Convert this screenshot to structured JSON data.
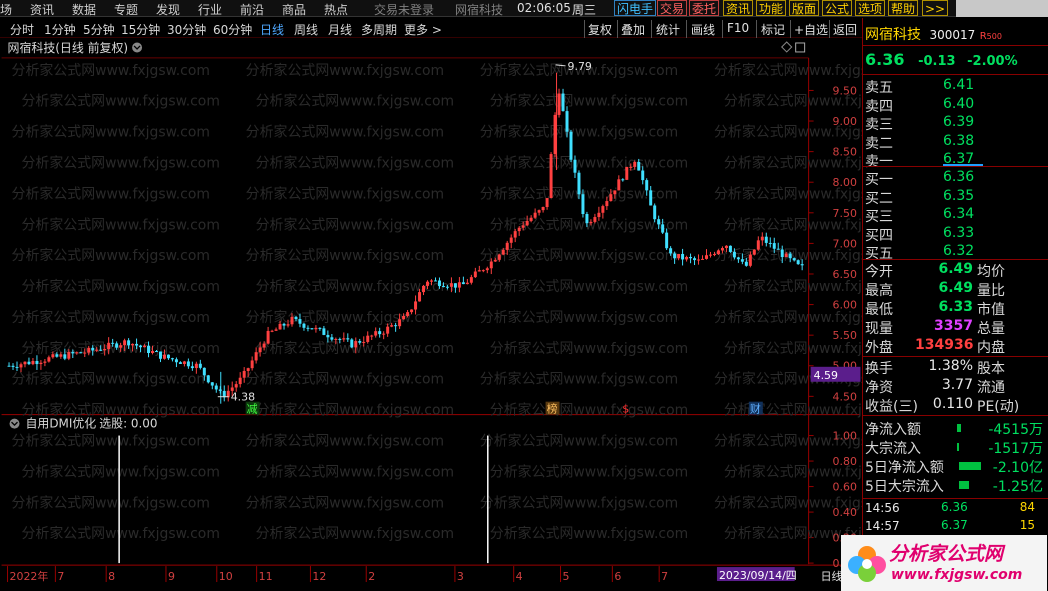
{
  "topmenu": {
    "items": [
      "场",
      "资讯",
      "数据",
      "专题",
      "发现",
      "行业",
      "前沿",
      "商品",
      "热点"
    ],
    "trade_status": "交易未登录",
    "stock_name": "网宿科技",
    "clock": "02:06:05",
    "weekday": "周三",
    "buttons": [
      "闪电手",
      "交易",
      "委托",
      "资讯",
      "功能",
      "版面",
      "公式",
      "选项",
      "帮助",
      ">>"
    ]
  },
  "periodbar": {
    "periods": [
      "分时",
      "1分钟",
      "5分钟",
      "15分钟",
      "30分钟",
      "60分钟",
      "日线",
      "周线",
      "月线",
      "多周期",
      "更多 >"
    ],
    "active_index": 6,
    "tools": [
      "复权",
      "叠加",
      "统计",
      "画线",
      "F10",
      "标记",
      "+自选",
      "返回"
    ]
  },
  "chart": {
    "title": "网宿科技(日线 前复权)",
    "watermark": "分析家公式网www.fxjgsw.com",
    "high_label": "9.79",
    "low_label": "4.38",
    "current_marker": "4.59",
    "events": [
      "减",
      "榜",
      "$",
      "财"
    ],
    "indicator_title": "自用DMI优化",
    "indicator_value": "选股: 0.00",
    "date_ticks": [
      "2022年",
      "7",
      "8",
      "9",
      "10",
      "11",
      "12",
      "2",
      "3",
      "4",
      "5",
      "6",
      "7"
    ],
    "date_current": "2023/09/14/四",
    "date_mode": "日线"
  },
  "chart_data": {
    "type": "candlestick",
    "ylim": [
      4.25,
      9.95
    ],
    "yticks": [
      "9.50",
      "9.00",
      "8.50",
      "8.00",
      "7.50",
      "7.00",
      "6.50",
      "6.00",
      "5.50",
      "5.00",
      "4.50"
    ],
    "indicator_ylim": [
      0,
      1
    ],
    "indicator_yticks": [
      "1.00",
      "0.80",
      "0.60",
      "0.40",
      "0.20",
      "0.00"
    ],
    "signals": [
      1,
      1
    ]
  },
  "quote": {
    "name": "网宿科技",
    "code": "300017",
    "badge": "R",
    "badge_num": "500",
    "price": "6.36",
    "change": "-0.13",
    "change_pct": "-2.00%",
    "asks": [
      {
        "label": "卖五",
        "price": "6.41"
      },
      {
        "label": "卖四",
        "price": "6.40"
      },
      {
        "label": "卖三",
        "price": "6.39"
      },
      {
        "label": "卖二",
        "price": "6.38"
      },
      {
        "label": "卖一",
        "price": "6.37"
      }
    ],
    "bids": [
      {
        "label": "买一",
        "price": "6.36"
      },
      {
        "label": "买二",
        "price": "6.35"
      },
      {
        "label": "买三",
        "price": "6.34"
      },
      {
        "label": "买四",
        "price": "6.33"
      },
      {
        "label": "买五",
        "price": "6.32"
      }
    ],
    "stats": [
      {
        "l1": "今开",
        "v1": "6.49",
        "l2": "均价"
      },
      {
        "l1": "最高",
        "v1": "6.49",
        "l2": "量比"
      },
      {
        "l1": "最低",
        "v1": "6.33",
        "l2": "市值"
      },
      {
        "l1": "现量",
        "v1": "3357",
        "l2": "总量"
      },
      {
        "l1": "外盘",
        "v1": "134936",
        "l2": "内盘"
      }
    ],
    "stats2": [
      {
        "l1": "换手",
        "v1": "1.38%",
        "l2": "股本"
      },
      {
        "l1": "净资",
        "v1": "3.77",
        "l2": "流通"
      },
      {
        "l1": "收益(三)",
        "v1": "0.110",
        "l2": "PE(动)"
      }
    ],
    "flows": [
      {
        "label": "净流入额",
        "value": "-4515万"
      },
      {
        "label": "大宗流入",
        "value": "-1517万"
      },
      {
        "label": "5日净流入额",
        "value": "-2.10亿"
      },
      {
        "label": "5日大宗流入",
        "value": "-1.25亿"
      }
    ],
    "ticks": [
      {
        "time": "14:56",
        "price": "6.36",
        "vol": "84"
      },
      {
        "time": "14:57",
        "price": "6.37",
        "vol": "15"
      }
    ],
    "logo_text": "分析家公式网",
    "logo_url": "www.fxjgsw.com"
  }
}
